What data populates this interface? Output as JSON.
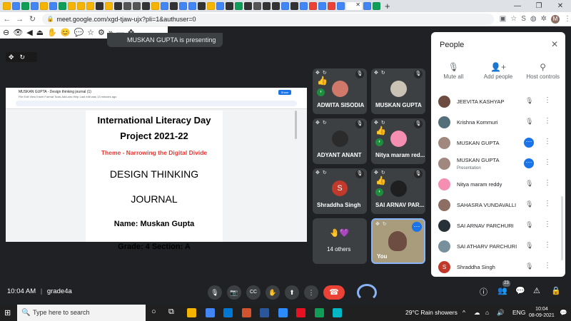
{
  "browser": {
    "tab_colors": [
      "#f4b400",
      "#4285f4",
      "#0f9d58",
      "#4285f4",
      "#f4b400",
      "#4285f4",
      "#0f9d58",
      "#f4b400",
      "#f4b400",
      "#f4b400",
      "#333333",
      "#f4b400",
      "#333333",
      "#555555",
      "#555555",
      "#333333",
      "#f4b400",
      "#4285f4",
      "#333333",
      "#4285f4",
      "#4285f4",
      "#333333",
      "#f4b400",
      "#4285f4",
      "#333333",
      "#0f9d58",
      "#333333",
      "#555555",
      "#333333",
      "#333333",
      "#4285f4",
      "#333333",
      "#4285f4",
      "#ea4335",
      "#4285f4",
      "#ea4335",
      "#4285f4",
      "#ea4335",
      "#4285f4",
      "#0f9d58"
    ],
    "new_tab": "+",
    "url": "meet.google.com/xgd-tjaw-ujx?pli=1&authuser=0",
    "profile_initial": "M",
    "window_controls": [
      "—",
      "❐",
      "✕"
    ]
  },
  "extensions": [
    "⊖",
    "👁",
    "◀",
    "⏏",
    "✋",
    "😊",
    "💬",
    "☆",
    "⚙",
    "»",
    "—",
    "✥"
  ],
  "meeting": {
    "presenting_banner": "MUSKAN GUPTA is presenting",
    "pip_controls": [
      "✥",
      "↻"
    ]
  },
  "presentation": {
    "doc_title": "MUSKAN GUPTA - Design thinking journal (1)",
    "doc_menu": "File  Edit  View  Insert  Format  Tools  Add-ons  Help   Last edit was 13 minutes ago",
    "share_label": "Share",
    "title_line1": "International Literacy Day",
    "title_line2": "Project 2021-22",
    "theme": "Theme - Narrowing the Digital Divide",
    "journal_line1": "DESIGN THINKING",
    "journal_line2": "JOURNAL",
    "name_line": "Name: Muskan Gupta",
    "grade_line": "Grade: 4 Section: A"
  },
  "tiles": [
    {
      "name": "ADWITA SISODIA",
      "hand": "👍",
      "audio": "◗",
      "pic_color": "#d0796b"
    },
    {
      "name": "MUSKAN GUPTA",
      "pic_color": "#c9c2b5"
    },
    {
      "name": "ADYANT ANANT",
      "pic_color": "#2b2b2b"
    },
    {
      "name": "Nitya maram red...",
      "hand": "👍",
      "audio": "◗",
      "pic_color": "#f48fb1"
    },
    {
      "name": "Shraddha Singh",
      "letter": "S"
    },
    {
      "name": "SAI ARNAV PAR...",
      "hand": "👍",
      "audio": "◗",
      "pic_color": "#1f1f1f"
    },
    {
      "name": "14 others"
    },
    {
      "name": "You"
    }
  ],
  "tile_controls": [
    "✥",
    "↻"
  ],
  "muted_icon": "🎙",
  "more_icon": "⋯",
  "others_avatars": "🤚💜",
  "people_panel": {
    "title": "People",
    "close": "✕",
    "actions": [
      {
        "label": "Mute all",
        "icon": "🎙"
      },
      {
        "label": "Add people",
        "icon": "👤+"
      },
      {
        "label": "Host controls",
        "icon": "⚲"
      }
    ],
    "participants": [
      {
        "name": "JEEVITA KASHYAP",
        "sub": "",
        "color": "#6d4c41",
        "status": "muted"
      },
      {
        "name": "Krishna Kommuri",
        "sub": "",
        "color": "#546e7a",
        "status": "muted"
      },
      {
        "name": "MUSKAN GUPTA",
        "sub": "",
        "color": "#a1887f",
        "status": "speaking"
      },
      {
        "name": "MUSKAN GUPTA",
        "sub": "Presentation",
        "color": "#a1887f",
        "status": "speaking"
      },
      {
        "name": "Nitya maram reddy",
        "sub": "",
        "color": "#f48fb1",
        "status": "muted"
      },
      {
        "name": "SAHASRA VUNDAVALLI",
        "sub": "",
        "color": "#8d6e63",
        "status": "muted"
      },
      {
        "name": "SAI ARNAV PARCHURI",
        "sub": "",
        "color": "#263238",
        "status": "muted"
      },
      {
        "name": "SAI ATHARV PARCHURI",
        "sub": "",
        "color": "#78909c",
        "status": "muted"
      },
      {
        "name": "Shraddha Singh",
        "sub": "",
        "color": "#c0392b",
        "letter": "S",
        "status": "muted"
      }
    ],
    "mute_icon": "🎙",
    "more_icon": "⋮",
    "speaking_icon": "⋯"
  },
  "bottom": {
    "time": "10:04 AM",
    "separator": "|",
    "meeting_code": "grade4a",
    "controls": [
      "🎙",
      "📷",
      "CC",
      "✋",
      "⬆",
      "⋮"
    ],
    "end_call": "☎",
    "right_icons": [
      "ⓘ",
      "👥",
      "💬",
      "⚠",
      "🔒"
    ],
    "participant_count": "23"
  },
  "taskbar": {
    "start": "⊞",
    "search_placeholder": "Type here to search",
    "search_icon": "🔍",
    "task_icons": [
      "○",
      "⧉"
    ],
    "apps": [
      "#f4b400",
      "#4285f4",
      "#0078d4",
      "#d35230",
      "#2b579a",
      "#2d8cff",
      "#e81123",
      "#0f9d58",
      "#00b7c3"
    ],
    "weather": "29°C  Rain showers",
    "lang": "ENG",
    "time": "10:04",
    "date": "08-09-2021",
    "tray_icons": [
      "^",
      "☁",
      "🔊",
      "💬"
    ]
  }
}
